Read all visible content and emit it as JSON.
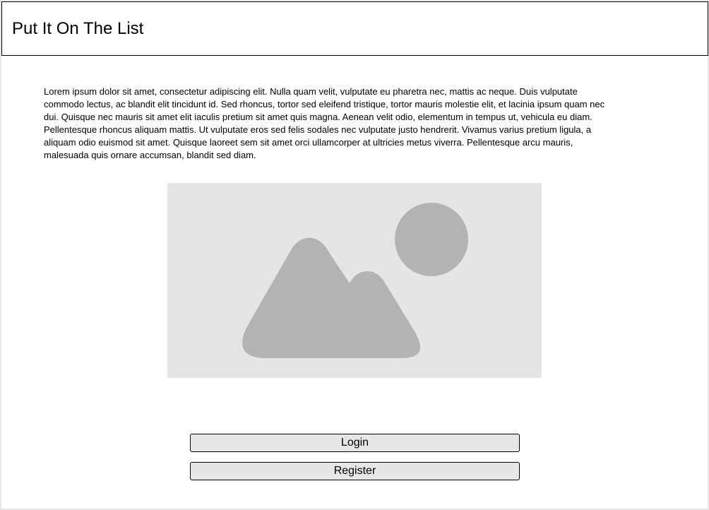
{
  "header": {
    "title": "Put It On The List"
  },
  "main": {
    "intro_text": "Lorem ipsum dolor sit amet, consectetur adipiscing elit. Nulla quam velit, vulputate eu pharetra nec, mattis ac neque. Duis vulputate commodo lectus, ac blandit elit tincidunt id. Sed rhoncus, tortor sed eleifend tristique, tortor mauris molestie elit, et lacinia ipsum quam nec dui. Quisque nec mauris sit amet elit iaculis pretium sit amet quis magna. Aenean velit odio, elementum in tempus ut, vehicula eu diam. Pellentesque rhoncus aliquam mattis. Ut vulputate eros sed felis sodales nec vulputate justo hendrerit. Vivamus varius pretium ligula, a aliquam odio euismod sit amet. Quisque laoreet sem sit amet orci ullamcorper at ultricies metus viverra. Pellentesque arcu mauris, malesuada quis ornare accumsan, blandit sed diam.",
    "image": {
      "icon": "image-placeholder-icon",
      "background_color": "#e5e5e5",
      "shape_color": "#b3b3b3"
    }
  },
  "actions": {
    "login_label": "Login",
    "register_label": "Register"
  }
}
